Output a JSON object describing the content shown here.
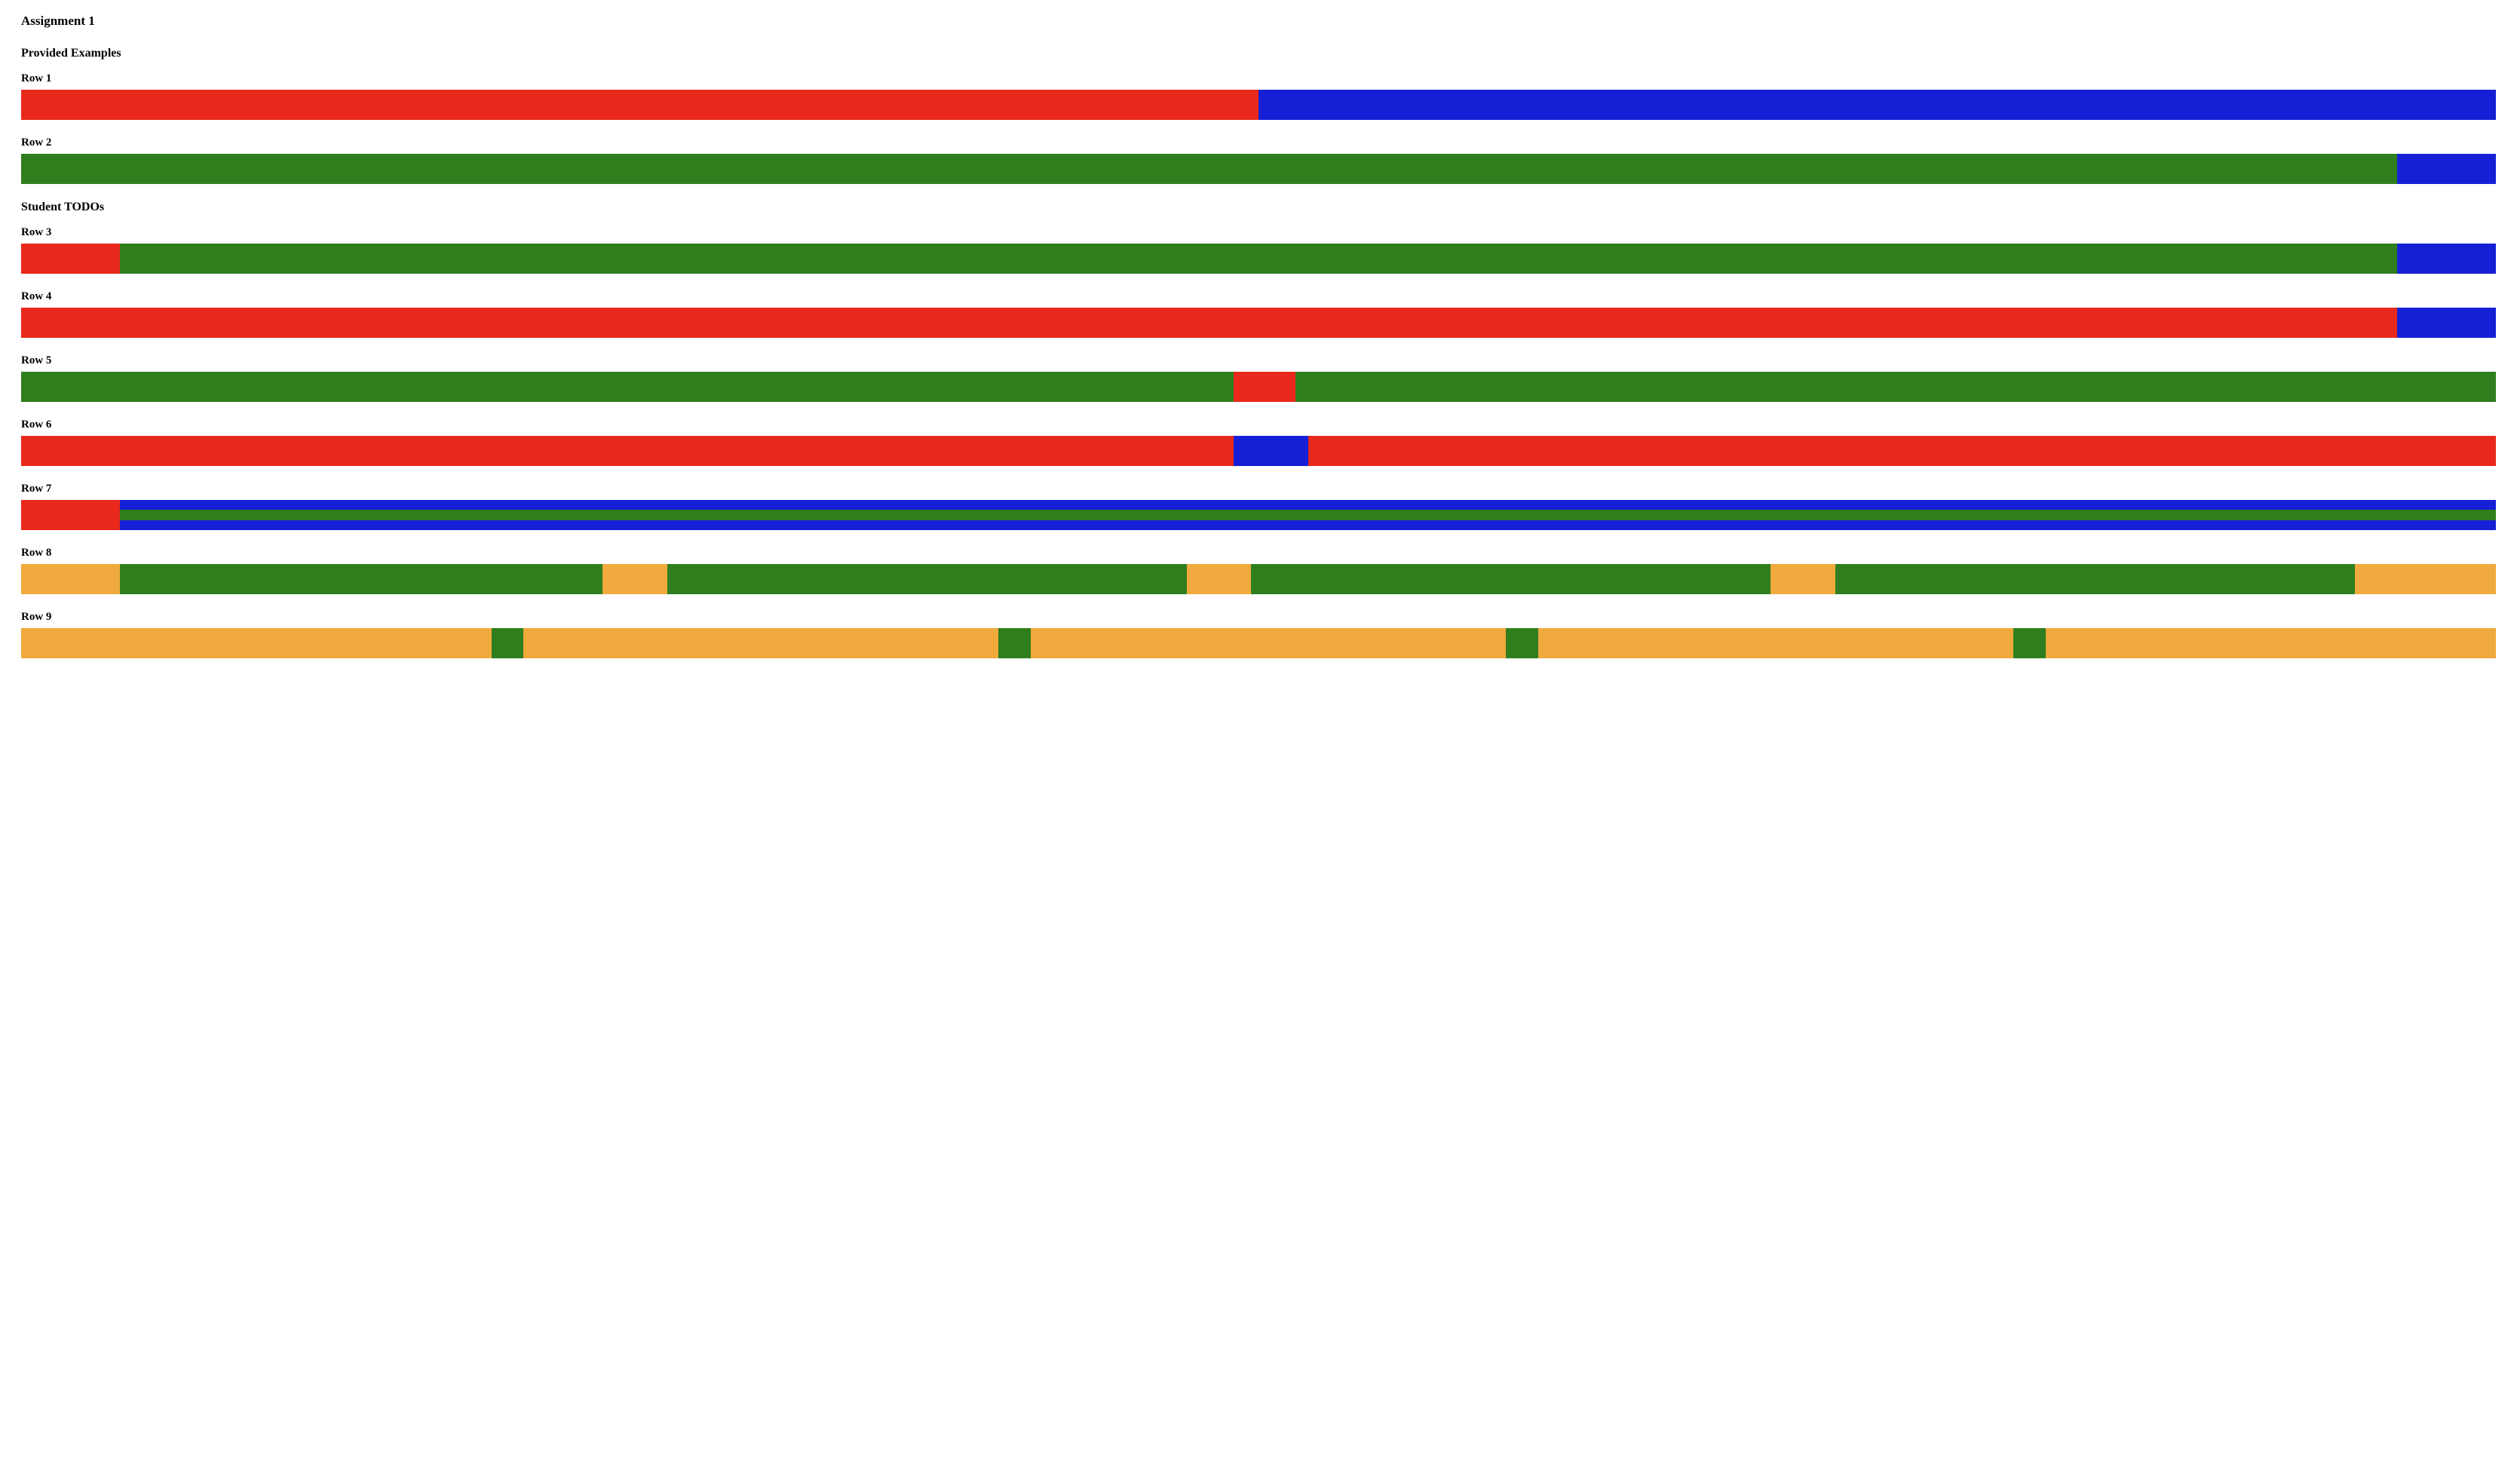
{
  "title": "Assignment 1",
  "section_provided": "Provided Examples",
  "section_todos": "Student TODOs",
  "colors": {
    "red": "#e8291c",
    "blue": "#1520d6",
    "green": "#2f7e1e",
    "orange": "#f0a93c"
  },
  "rows": [
    {
      "label": "Row 1",
      "bar": [
        {
          "c": "red",
          "w": 50
        },
        {
          "c": "blue",
          "w": 50
        }
      ]
    },
    {
      "label": "Row 2",
      "bar": [
        {
          "c": "green",
          "w": 96
        },
        {
          "c": "blue",
          "w": 4
        }
      ]
    },
    {
      "label": "Row 3",
      "bar": [
        {
          "c": "red",
          "w": 4
        },
        {
          "c": "green",
          "w": 92
        },
        {
          "c": "blue",
          "w": 4
        }
      ]
    },
    {
      "label": "Row 4",
      "bar": [
        {
          "c": "red",
          "w": 96
        },
        {
          "c": "blue",
          "w": 4
        }
      ]
    },
    {
      "label": "Row 5",
      "bar": [
        {
          "c": "green",
          "w": 49
        },
        {
          "c": "red",
          "w": 2.5
        },
        {
          "c": "green",
          "w": 48.5
        }
      ]
    },
    {
      "label": "Row 6",
      "bar": [
        {
          "c": "red",
          "w": 49
        },
        {
          "c": "blue",
          "w": 3
        },
        {
          "c": "red",
          "w": 48
        }
      ]
    },
    {
      "label": "Row 7",
      "striped": {
        "left": {
          "c": "red",
          "w": 4
        },
        "right": [
          {
            "c": "blue"
          },
          {
            "c": "green"
          },
          {
            "c": "blue"
          }
        ]
      }
    },
    {
      "label": "Row 8",
      "bar": [
        {
          "c": "orange",
          "w": 4
        },
        {
          "c": "green",
          "w": 19.5
        },
        {
          "c": "orange",
          "w": 2.6
        },
        {
          "c": "green",
          "w": 21
        },
        {
          "c": "orange",
          "w": 2.6
        },
        {
          "c": "green",
          "w": 21
        },
        {
          "c": "orange",
          "w": 2.6
        },
        {
          "c": "green",
          "w": 21
        },
        {
          "c": "orange",
          "w": 5.7
        }
      ]
    },
    {
      "label": "Row 9",
      "bar": [
        {
          "c": "orange",
          "w": 19
        },
        {
          "c": "green",
          "w": 1.3
        },
        {
          "c": "orange",
          "w": 19.2
        },
        {
          "c": "green",
          "w": 1.3
        },
        {
          "c": "orange",
          "w": 19.2
        },
        {
          "c": "green",
          "w": 1.3
        },
        {
          "c": "orange",
          "w": 19.2
        },
        {
          "c": "green",
          "w": 1.3
        },
        {
          "c": "orange",
          "w": 18.2
        }
      ]
    }
  ]
}
